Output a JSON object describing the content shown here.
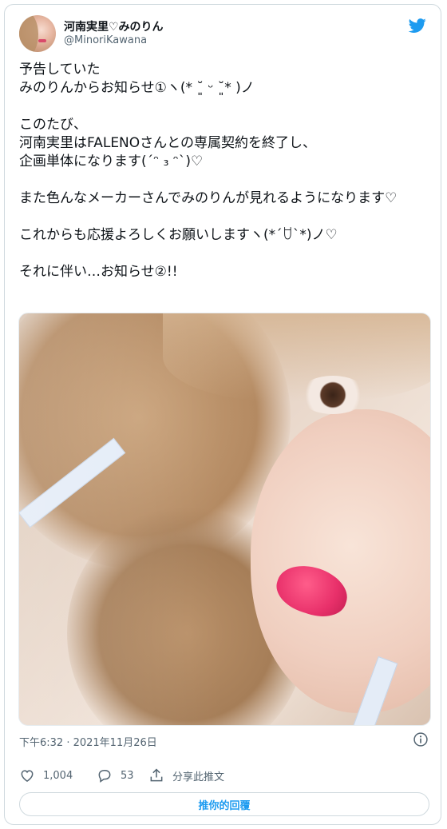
{
  "user": {
    "display_name": "河南実里♡みのりん",
    "handle": "@MinoriKawana"
  },
  "tweet": {
    "text": "予告していた\nみのりんからお知らせ①ヽ(* ˘͈ ᵕ ˘͈* )ノ\n\nこのたび、\n河南実里はFALENOさんとの専属契約を終了し、\n企画単体になります(´ᵔ ₃ ᵔ`)♡\n\nまた色んなメーカーさんでみのりんが見れるようになります♡\n\nこれからも応援よろしくお願いしますヽ(*´ꇴ`*)ノ♡\n\nそれに伴い…お知らせ②!!"
  },
  "meta": {
    "timestamp": "下午6:32 · 2021年11月26日"
  },
  "actions": {
    "likes": "1,004",
    "replies": "53",
    "share_label": "分享此推文"
  },
  "reply_button": {
    "label": "推你的回覆"
  },
  "icons": {
    "brand": "twitter-bird-icon",
    "info": "info-icon",
    "like": "heart-icon",
    "reply": "speech-bubble-icon",
    "share": "share-upload-icon"
  },
  "colors": {
    "accent": "#1d9bf0",
    "text": "#0f1419",
    "muted": "#536471",
    "border": "#cfd9de"
  }
}
